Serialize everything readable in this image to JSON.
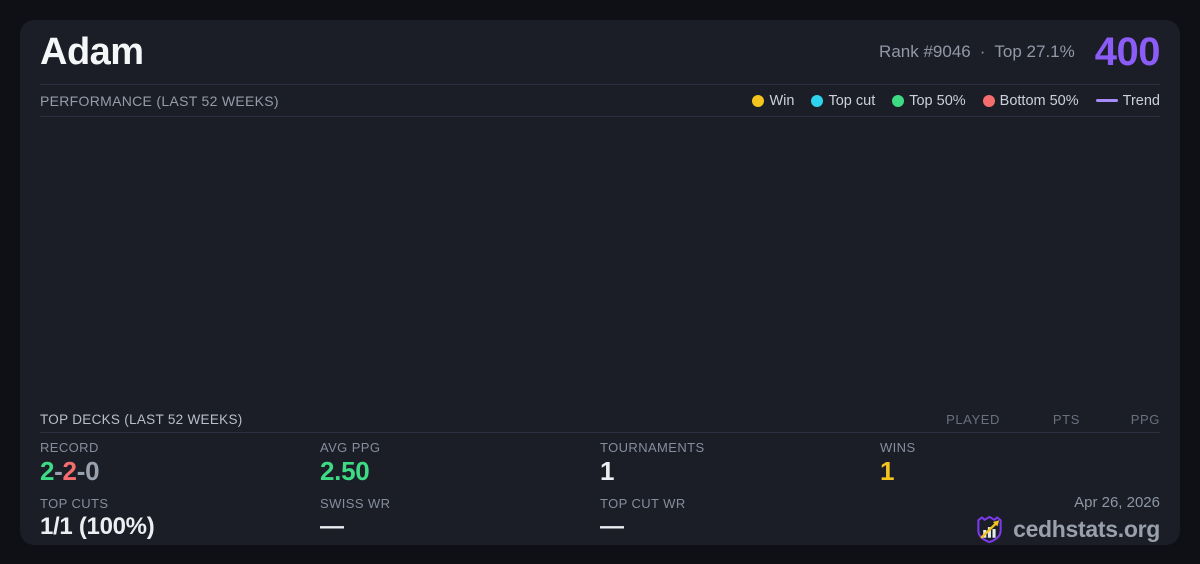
{
  "card": {
    "player_name": "Adam",
    "rank_text": "Rank #9046",
    "separator": "·",
    "percentile_text": "Top 27.1%",
    "points": "400"
  },
  "colors": {
    "accent_purple": "#8b5cf6",
    "win_yellow": "#f2c41d",
    "top_cut_cyan": "#2ed3ee",
    "top50_green": "#3ddc84",
    "bottom50_red": "#f56d6d",
    "trend_purple": "#a78bfa",
    "card_bg": "#1b1d27",
    "page_bg": "#0f1015"
  },
  "performance": {
    "title": "PERFORMANCE (LAST 52 WEEKS)",
    "legend": [
      {
        "label": "Win",
        "color": "#f2c41d",
        "marker": "dot"
      },
      {
        "label": "Top cut",
        "color": "#2ed3ee",
        "marker": "dot"
      },
      {
        "label": "Top 50%",
        "color": "#3ddc84",
        "marker": "dot"
      },
      {
        "label": "Bottom 50%",
        "color": "#f56d6d",
        "marker": "dot"
      },
      {
        "label": "Trend",
        "color": "#a78bfa",
        "marker": "line"
      }
    ]
  },
  "chart_data": {
    "type": "scatter",
    "title": "PERFORMANCE (LAST 52 WEEKS)",
    "x_range": "last 52 weeks",
    "legend_position": "top-right",
    "grid": false,
    "series": [
      {
        "name": "Win",
        "points": []
      },
      {
        "name": "Top cut",
        "points": []
      },
      {
        "name": "Top 50%",
        "points": []
      },
      {
        "name": "Bottom 50%",
        "points": []
      },
      {
        "name": "Trend",
        "points": []
      }
    ],
    "note": "Plot area is rendered empty in the screenshot; no data points, axes or gridlines are visible."
  },
  "decks": {
    "title": "TOP DECKS (LAST 52 WEEKS)",
    "columns": [
      "PLAYED",
      "PTS",
      "PPG"
    ],
    "rows": []
  },
  "stats": {
    "record": {
      "label": "RECORD",
      "wins": "2",
      "losses": "2",
      "draws": "0",
      "dash": "-"
    },
    "avg_ppg": {
      "label": "AVG PPG",
      "value": "2.50"
    },
    "tournaments": {
      "label": "TOURNAMENTS",
      "value": "1"
    },
    "wins": {
      "label": "WINS",
      "value": "1"
    },
    "top_cuts": {
      "label": "TOP CUTS",
      "value": "1/1 (100%)"
    },
    "swiss_wr": {
      "label": "SWISS WR",
      "value": "—"
    },
    "top_cut_wr": {
      "label": "TOP CUT WR",
      "value": "—"
    }
  },
  "footer": {
    "date": "Apr 26, 2026",
    "brand": "cedhstats.org"
  }
}
